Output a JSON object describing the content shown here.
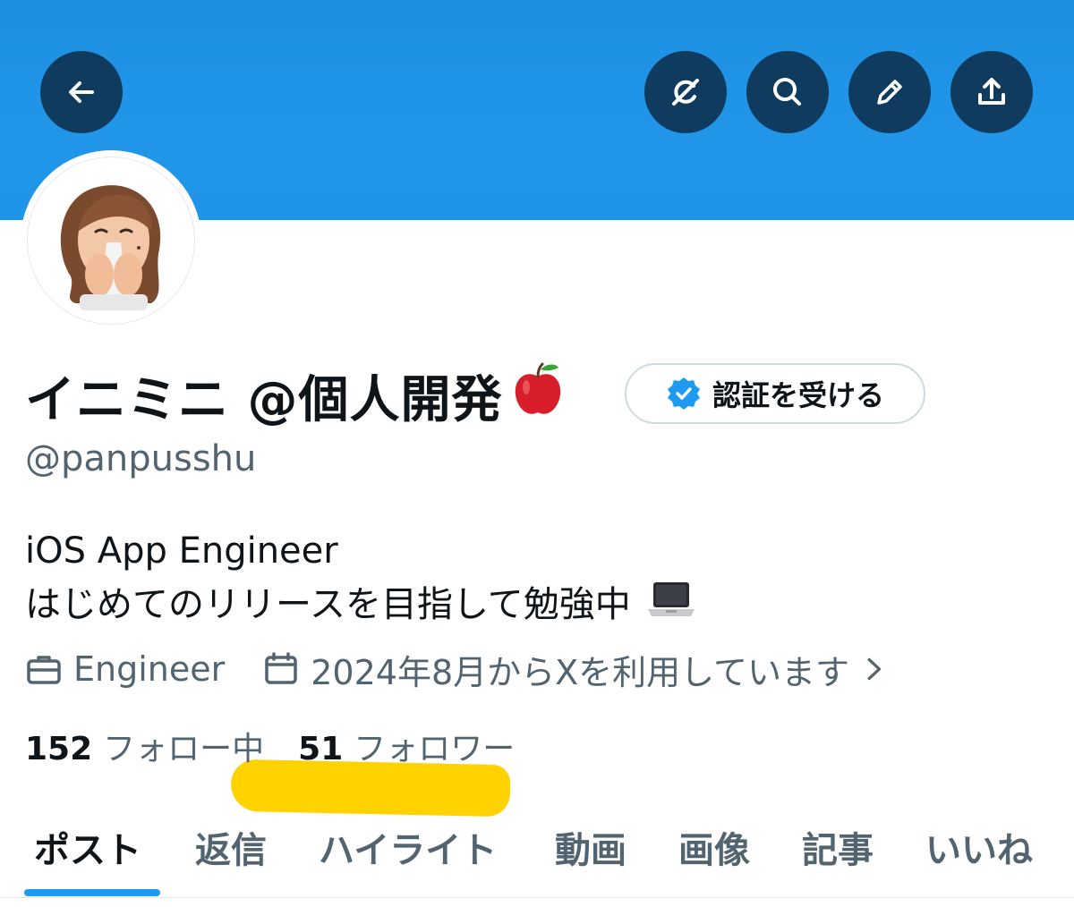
{
  "profile": {
    "display_name": "イニミニ @個人開発",
    "verify_label": "認証を受ける",
    "handle": "@panpusshu",
    "bio_line1": "iOS App Engineer",
    "bio_line2": "はじめてのリリースを目指して勉強中",
    "job": "Engineer",
    "joined": "2024年8月からXを利用しています",
    "following_count": "152",
    "following_label": "フォロー中",
    "followers_count": "51",
    "followers_label": "フォロワー"
  },
  "tabs": [
    {
      "label": "ポスト",
      "active": true
    },
    {
      "label": "返信"
    },
    {
      "label": "ハイライト"
    },
    {
      "label": "動画"
    },
    {
      "label": "画像"
    },
    {
      "label": "記事"
    },
    {
      "label": "いいね"
    }
  ],
  "icons": {
    "back": "arrow-left-icon",
    "grok": "grok-icon",
    "search": "search-icon",
    "edit": "pencil-icon",
    "share": "share-icon",
    "verified": "verified-badge-icon",
    "job": "briefcase-icon",
    "joined": "calendar-icon",
    "chevron": "chevron-right-icon"
  },
  "colors": {
    "banner": "#1f95e8",
    "button_bg": "#0f3b5e",
    "accent": "#1d9bf0",
    "highlight": "#ffd200",
    "secondary_text": "#536471"
  }
}
